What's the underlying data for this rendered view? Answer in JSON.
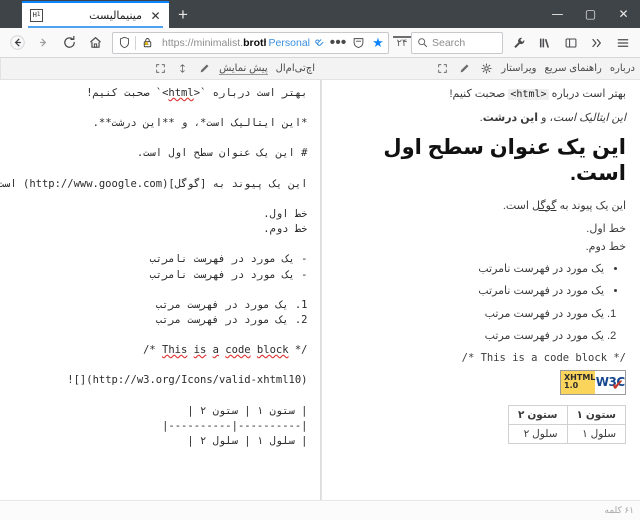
{
  "browser": {
    "tab": {
      "title": "مینیمالیست",
      "favicon_label": "M",
      "close_label": "✕"
    },
    "newtab_label": "+",
    "window_controls": {
      "minimize": "—",
      "maximize": "▢",
      "close": "✕"
    },
    "nav": {
      "back": "back-arrow",
      "forward": "forward-arrow",
      "reload": "reload",
      "home": "home"
    },
    "url": {
      "prefix": "https://minimalist.",
      "domain": "brothe",
      "suffix": "",
      "container_label": "Personal",
      "shield_icon": "shield-icon",
      "lock_icon": "lock-warning-icon"
    },
    "url_actions": {
      "page_actions": "•••",
      "reader": "reader-icon",
      "bookmark": "★"
    },
    "counter_badge": "۲۴",
    "search": {
      "placeholder": "Search",
      "value": ""
    },
    "right_icons": [
      "wrench-icon",
      "library-icon",
      "sidebar-icon",
      "overflow-icon",
      "menu-icon"
    ]
  },
  "apptoolbar": {
    "left": {
      "html_label": "اچ‌تی‌ام‌ال",
      "preview_label": "پیش نمایش",
      "pen_icon": "pen-icon",
      "resize_icon": "resize-icon",
      "fullscreen_icon": "fullscreen-icon"
    },
    "right": {
      "about_label": "درباره",
      "quickguide_label": "راهنمای سریع",
      "editor_label": "ویراستار",
      "gear_icon": "gear-icon",
      "pen_icon": "pen-icon",
      "fullscreen_icon": "fullscreen-icon"
    }
  },
  "preview": {
    "p1_before": "بهتر است درباره ",
    "p1_code": "<html>",
    "p1_after": " صحبت کنیم!",
    "p2_italic": "این ایتالیک است",
    "p2_mid": "، و ",
    "p2_bold": "این درشت",
    "p2_end": ".",
    "h1": "این یک عنوان سطح اول است.",
    "p3_before": "این یک پیوند به ",
    "p3_link": "گوگل",
    "p3_after": " است.",
    "line1": "خط اول.",
    "line2": "خط دوم.",
    "ul": [
      "یک مورد در فهرست نامرتب",
      "یک مورد در فهرست نامرتب"
    ],
    "ol": [
      "یک مورد در فهرست مرتب",
      "یک مورد در فهرست مرتب"
    ],
    "code_block": "/* This is a code block */",
    "badge": {
      "w3c": "W3C",
      "line1": "XHTML",
      "line2": "1.0",
      "check": "✔"
    },
    "table": {
      "headers": [
        "ستون ۱",
        "ستون ۲"
      ],
      "rows": [
        [
          "سلول ۱",
          "سلول ۲"
        ]
      ]
    }
  },
  "editor": {
    "lines": [
      {
        "text": "بهتر است درباره `<html>` صحبت کنیم!",
        "rtl": true
      },
      {
        "text": "",
        "rtl": true
      },
      {
        "text": "*این ایتالیک است*، و **این درشت**.",
        "rtl": true
      },
      {
        "text": "",
        "rtl": true
      },
      {
        "text": "# این یک عنوان سطح اول است.",
        "rtl": true
      },
      {
        "text": "",
        "rtl": true
      },
      {
        "text": "این یک پیوند به [گوگل](http://www.google.com) است.",
        "rtl": true
      },
      {
        "text": "",
        "rtl": true
      },
      {
        "text": "خط اول.",
        "rtl": true
      },
      {
        "text": "خط دوم.",
        "rtl": true
      },
      {
        "text": "",
        "rtl": true
      },
      {
        "text": "- یک مورد در فهرست نامرتب",
        "rtl": true
      },
      {
        "text": "- یک مورد در فهرست نامرتب",
        "rtl": true
      },
      {
        "text": "",
        "rtl": true
      },
      {
        "text": "1. یک مورد در فهرست مرتب",
        "rtl": true
      },
      {
        "text": "2. یک مورد در فهرست مرتب",
        "rtl": true
      },
      {
        "text": "",
        "rtl": true
      },
      {
        "text": "/* This is a code block */",
        "rtl": false
      },
      {
        "text": "",
        "rtl": true
      },
      {
        "text": "![](http://w3.org/Icons/valid-xhtml10)",
        "rtl": false
      },
      {
        "text": "",
        "rtl": true
      },
      {
        "text": "| ستون ۱ | ستون ۲ |",
        "rtl": true
      },
      {
        "text": "|----------|----------|",
        "rtl": true
      },
      {
        "text": "| سلول ۱ | سلول ۲ |",
        "rtl": true
      }
    ]
  },
  "statusbar": {
    "word_count": "۶۱ کلمه"
  }
}
